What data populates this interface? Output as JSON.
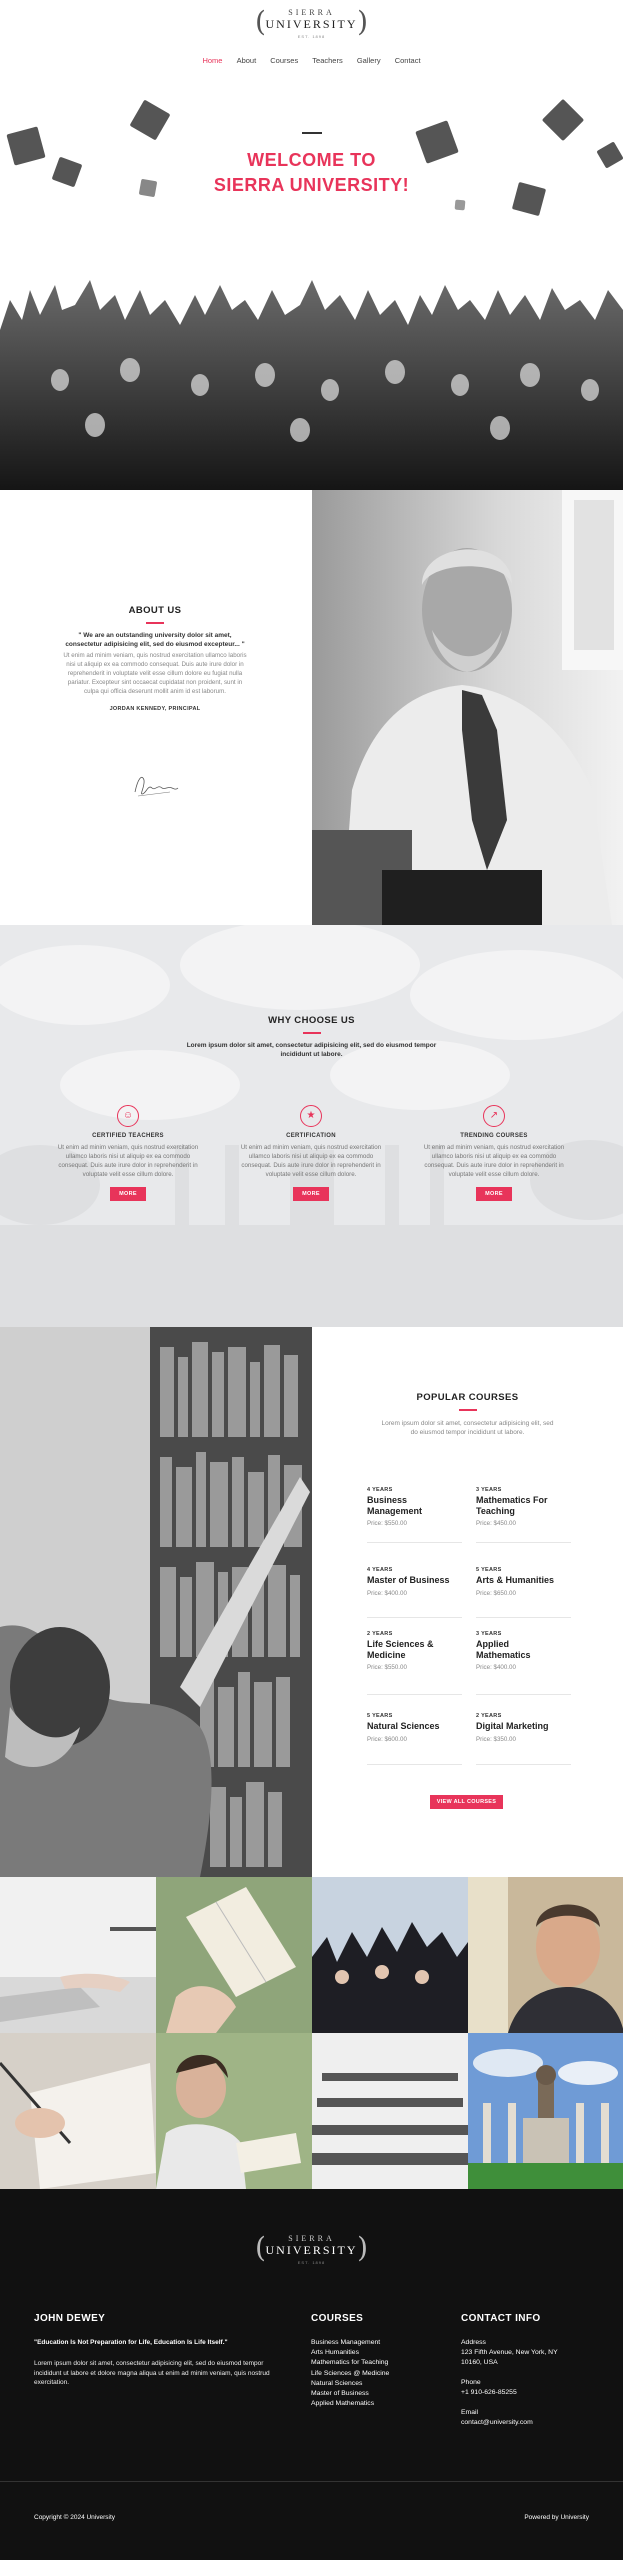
{
  "brand": {
    "logo_line1": "SIERRA",
    "logo_line2": "UNIVERSITY",
    "logo_line3": "EST. 1898",
    "accent_color": "#e8345a"
  },
  "nav": {
    "items": [
      "Home",
      "About",
      "Courses",
      "Teachers",
      "Gallery",
      "Contact"
    ],
    "active": "Home"
  },
  "hero": {
    "title_line1": "WELCOME TO",
    "title_line2": "SIERRA UNIVERSITY!",
    "image": "graduates-throwing-caps-photo"
  },
  "about": {
    "title": "ABOUT US",
    "quote": "\" We are an outstanding university dolor sit amet, consectetur adipisicing elit, sed do eiusmod excepteur... \"",
    "body": "Ut enim ad minim veniam, quis nostrud exercitation ullamco laboris nisi ut aliquip ex ea commodo consequat. Duis aute irure dolor in reprehenderit in voluptate velit esse cillum dolore eu fugiat nulla pariatur. Excepteur sint occaecat cupidatat non proident, sunt in culpa qui officia deserunt mollit anim id est laborum.",
    "signatory": "JORDAN KENNEDY, PRINCIPAL",
    "image": "principal-portrait-photo"
  },
  "why": {
    "title": "WHY CHOOSE US",
    "subtitle": "Lorem ipsum dolor sit amet, consectetur adipisicing elit, sed do eiusmod tempor incididunt ut labore.",
    "features": [
      {
        "icon": "teacher-icon",
        "title": "CERTIFIED TEACHERS",
        "text": "Ut enim ad minim veniam, quis nostrud exercitation ullamco laboris nisi ut aliquip ex ea commodo consequat. Duis aute irure dolor in reprehenderit in voluptate velit esse cillum dolore.",
        "button": "MORE"
      },
      {
        "icon": "certificate-icon",
        "title": "CERTIFICATION",
        "text": "Ut enim ad minim veniam, quis nostrud exercitation ullamco laboris nisi ut aliquip ex ea commodo consequat. Duis aute irure dolor in reprehenderit in voluptate velit esse cillum dolore.",
        "button": "MORE"
      },
      {
        "icon": "trending-icon",
        "title": "TRENDING COURSES",
        "text": "Ut enim ad minim veniam, quis nostrud exercitation ullamco laboris nisi ut aliquip ex ea commodo consequat. Duis aute irure dolor in reprehenderit in voluptate velit esse cillum dolore.",
        "button": "MORE"
      }
    ]
  },
  "courses": {
    "title": "POPULAR COURSES",
    "subtitle": "Lorem ipsum dolor sit amet, consectetur adipisicing elit, sed do eiusmod tempor incididunt ut labore.",
    "items": [
      {
        "years": "4 YEARS",
        "name": "Business Management",
        "price": "Price: $550.00"
      },
      {
        "years": "3 YEARS",
        "name": "Mathematics For Teaching",
        "price": "Price: $450.00"
      },
      {
        "years": "4 YEARS",
        "name": "Master of Business",
        "price": "Price: $400.00"
      },
      {
        "years": "5 YEARS",
        "name": "Arts & Humanities",
        "price": "Price: $650.00"
      },
      {
        "years": "2 YEARS",
        "name": "Life Sciences & Medicine",
        "price": "Price: $550.00"
      },
      {
        "years": "3 YEARS",
        "name": "Applied Mathematics",
        "price": "Price: $400.00"
      },
      {
        "years": "5 YEARS",
        "name": "Natural Sciences",
        "price": "Price: $600.00"
      },
      {
        "years": "2 YEARS",
        "name": "Digital Marketing",
        "price": "Price: $350.00"
      }
    ],
    "button": "VIEW ALL COURSES",
    "image": "library-student-photo"
  },
  "gallery": {
    "tiles": [
      "laptop-typing-photo",
      "book-reading-photo",
      "graduates-cheering-photo",
      "thinking-man-photo",
      "writing-notes-photo",
      "student-reading-outdoors-photo",
      "lecture-hall-photo",
      "university-columns-photo"
    ]
  },
  "footer": {
    "col1_title": "JOHN DEWEY",
    "col1_quote": "\"Education Is Not Preparation for Life, Education Is Life Itself.\"",
    "col1_text": "Lorem ipsum dolor sit amet, consectetur adipisicing elit, sed do eiusmod tempor incididunt ut labore et dolore magna aliqua ut enim ad minim veniam, quis nostrud exercitation.",
    "col2_title": "COURSES",
    "col2_items": [
      "Business Management",
      "Arts Humanities",
      "Mathematics for Teaching",
      "Life Sciences @ Medicine",
      "Natural Sciences",
      "Master of Business",
      "Applied Mathematics"
    ],
    "col3_title": "CONTACT INFO",
    "address_label": "Address",
    "address_line1": "123 Fifth Avenue, New York, NY",
    "address_line2": "10160, USA",
    "phone_label": "Phone",
    "phone": "+1 910-626-85255",
    "email_label": "Email",
    "email": "contact@university.com",
    "copyright": "Copyright © 2024 University",
    "powered": "Powered by University"
  }
}
